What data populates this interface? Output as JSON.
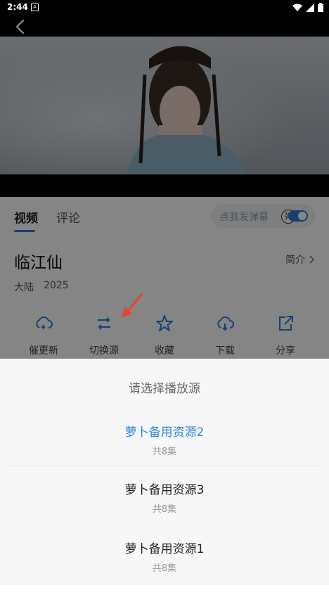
{
  "status_bar": {
    "time": "2:44"
  },
  "video_area": {},
  "tabs": [
    {
      "label": "视频",
      "active": true
    },
    {
      "label": "评论",
      "active": false
    }
  ],
  "danmaku": {
    "placeholder": "点我发弹幕",
    "badge": "弹",
    "enabled": true
  },
  "show": {
    "title": "临江仙",
    "intro_label": "简介",
    "region": "大陆",
    "year": "2025"
  },
  "actions": [
    {
      "label": "催更新",
      "icon": "cloud-refresh-icon"
    },
    {
      "label": "切换源",
      "icon": "switch-arrows-icon"
    },
    {
      "label": "收藏",
      "icon": "star-icon"
    },
    {
      "label": "下载",
      "icon": "cloud-download-icon"
    },
    {
      "label": "分享",
      "icon": "share-external-icon"
    }
  ],
  "source_sheet": {
    "title": "请选择播放源",
    "sources": [
      {
        "name": "萝卜备用资源2",
        "count": "共8集",
        "selected": true
      },
      {
        "name": "萝卜备用资源3",
        "count": "共8集",
        "selected": false
      },
      {
        "name": "萝卜备用资源1",
        "count": "共8集",
        "selected": false
      }
    ]
  },
  "colors": {
    "accent": "#2d7cd8",
    "selected_source": "#2d86d6",
    "overlay": "rgba(0,0,0,0.48)",
    "arrow": "#e8452f"
  }
}
